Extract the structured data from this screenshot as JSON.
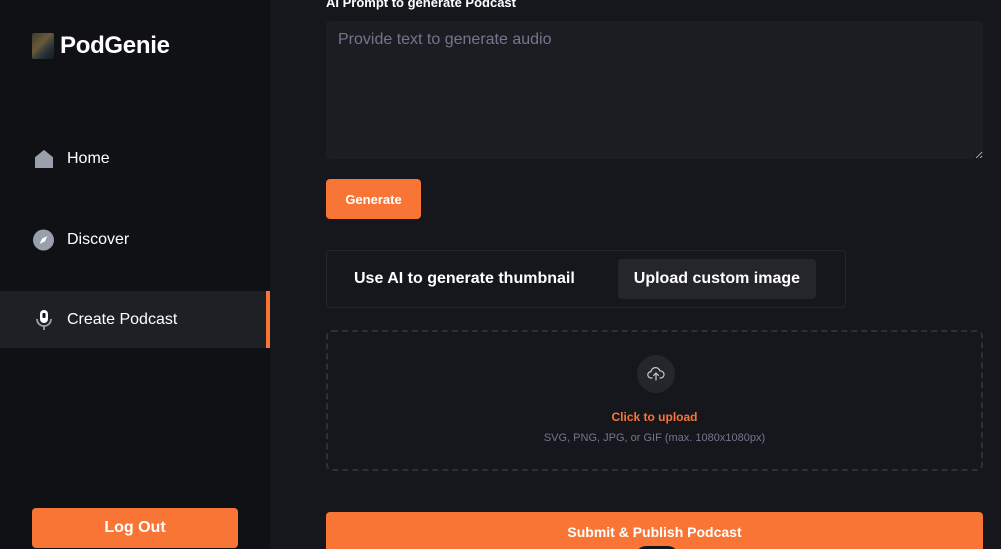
{
  "app": {
    "name": "PodGenie"
  },
  "sidebar": {
    "items": [
      {
        "label": "Home",
        "icon": "home-icon"
      },
      {
        "label": "Discover",
        "icon": "compass-icon"
      },
      {
        "label": "Create Podcast",
        "icon": "microphone-icon",
        "active": true
      }
    ],
    "logout_label": "Log Out"
  },
  "prompt": {
    "label": "AI Prompt to generate Podcast",
    "placeholder": "Provide text to generate audio",
    "generate_label": "Generate"
  },
  "thumbnail": {
    "tabs": [
      {
        "label": "Use AI to generate thumbnail",
        "active": false
      },
      {
        "label": "Upload custom image",
        "active": true
      }
    ],
    "click_upload": "Click to upload",
    "hint": "SVG, PNG, JPG, or GIF (max. 1080x1080px)"
  },
  "submit_label": "Submit & Publish Podcast",
  "colors": {
    "accent": "#f97535",
    "background": "#15171c",
    "sidebar": "#101114",
    "panel": "#1b1d22"
  }
}
